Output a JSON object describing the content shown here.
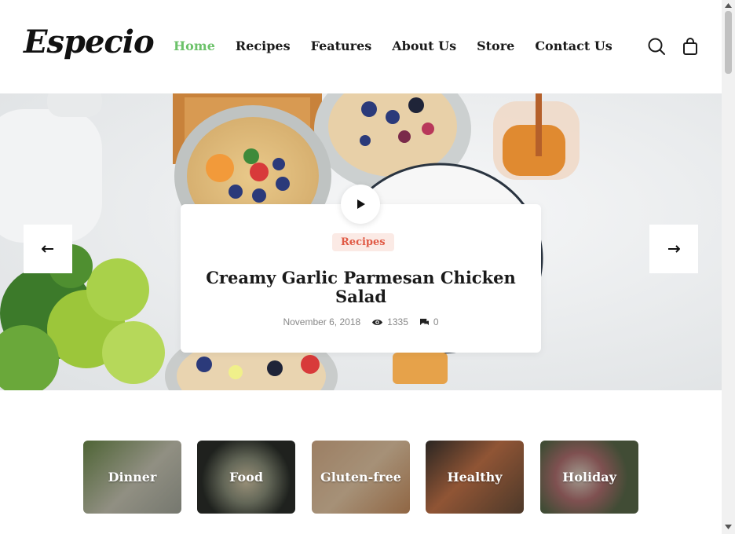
{
  "brand": {
    "logo_text": "Especio"
  },
  "nav": {
    "items": [
      {
        "label": "Home",
        "active": true
      },
      {
        "label": "Recipes",
        "active": false
      },
      {
        "label": "Features",
        "active": false
      },
      {
        "label": "About Us",
        "active": false
      },
      {
        "label": "Store",
        "active": false
      },
      {
        "label": "Contact Us",
        "active": false
      }
    ]
  },
  "header_icons": {
    "search": "search-icon",
    "cart": "shopping-bag-icon"
  },
  "hero": {
    "category": "Recipes",
    "title": "Creamy Garlic Parmesan Chicken Salad",
    "date": "November 6, 2018",
    "views": "1335",
    "comments": "0",
    "play_icon": "play-icon",
    "prev_icon": "arrow-left-icon",
    "next_icon": "arrow-right-icon"
  },
  "categories": [
    {
      "label": "Dinner"
    },
    {
      "label": "Food"
    },
    {
      "label": "Gluten-free"
    },
    {
      "label": "Healthy"
    },
    {
      "label": "Holiday"
    }
  ],
  "colors": {
    "accent": "#6cc26a",
    "badge_text": "#e05a45",
    "badge_bg": "#fbeae5",
    "text_dark": "#1a1a1a"
  }
}
